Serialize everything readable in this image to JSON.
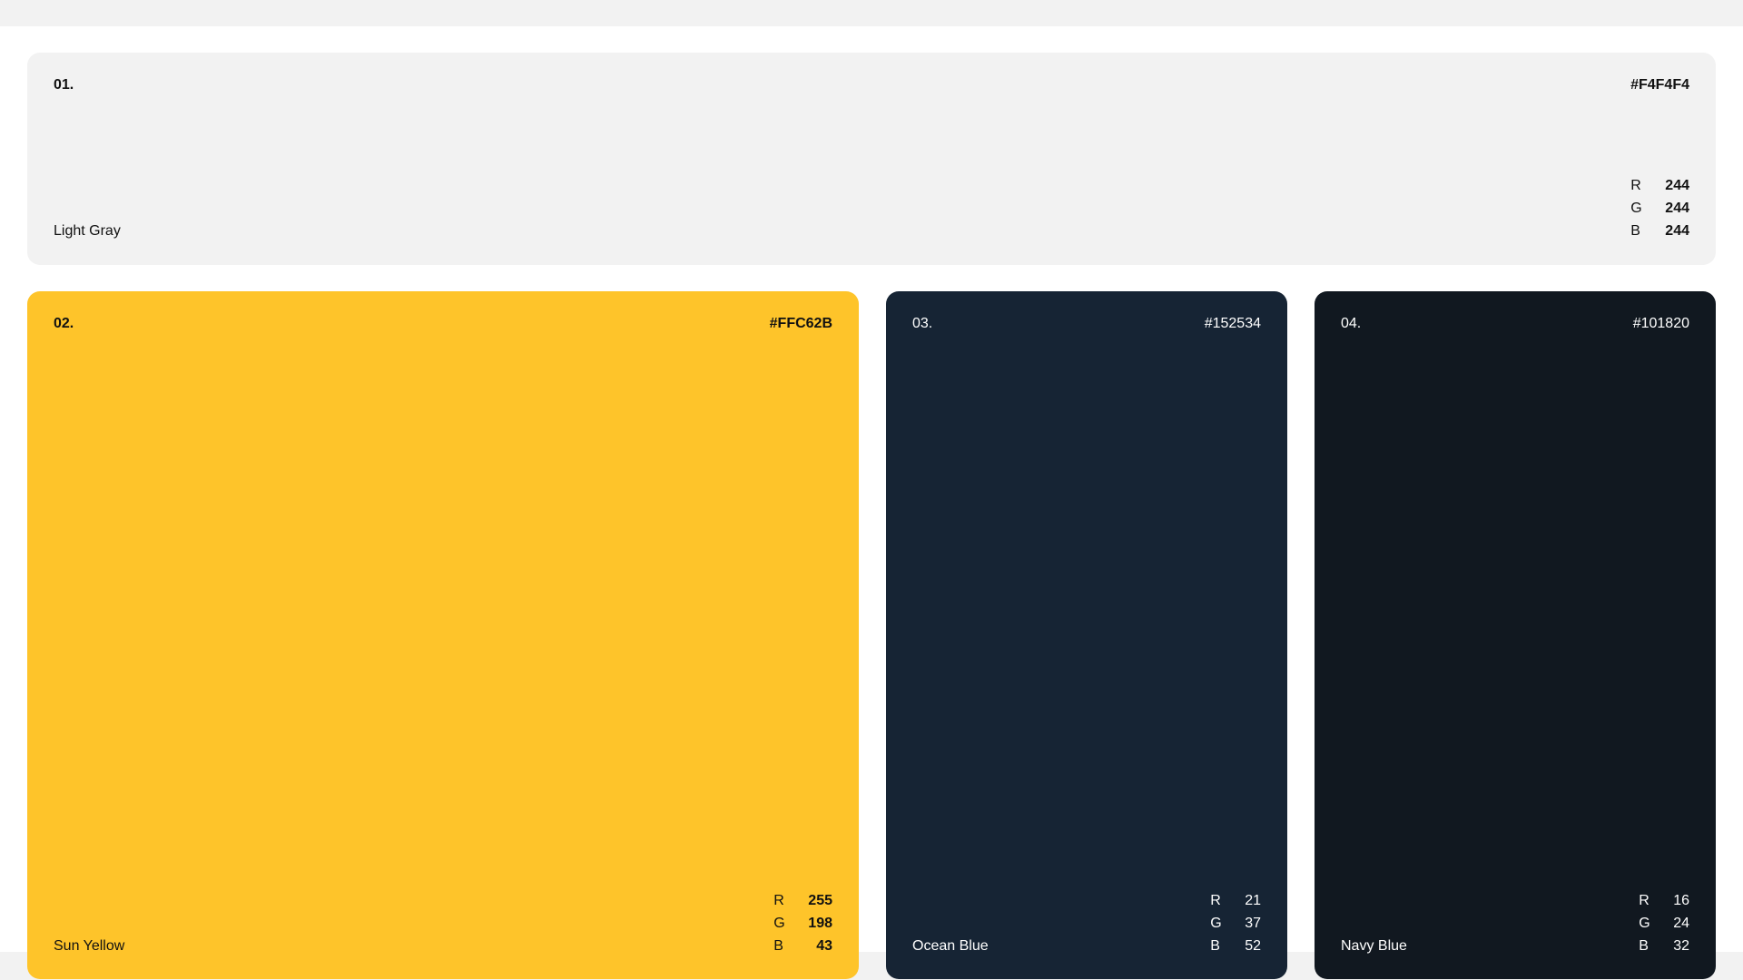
{
  "swatches": [
    {
      "index": "01.",
      "hex": "#F4F4F4",
      "name": "Light Gray",
      "color": "#f2f2f2",
      "rgb": {
        "r_label": "R",
        "r": "244",
        "g_label": "G",
        "g": "244",
        "b_label": "B",
        "b": "244"
      }
    },
    {
      "index": "02.",
      "hex": "#FFC62B",
      "name": "Sun Yellow",
      "color": "#fec42a",
      "rgb": {
        "r_label": "R",
        "r": "255",
        "g_label": "G",
        "g": "198",
        "b_label": "B",
        "b": "43"
      }
    },
    {
      "index": "03.",
      "hex": "#152534",
      "name": "Ocean Blue",
      "color": "#162434",
      "rgb": {
        "r_label": "R",
        "r": "21",
        "g_label": "G",
        "g": "37",
        "b_label": "B",
        "b": "52"
      }
    },
    {
      "index": "04.",
      "hex": "#101820",
      "name": "Navy Blue",
      "color": "#111820",
      "rgb": {
        "r_label": "R",
        "r": "16",
        "g_label": "G",
        "g": "24",
        "b_label": "B",
        "b": "32"
      }
    }
  ]
}
